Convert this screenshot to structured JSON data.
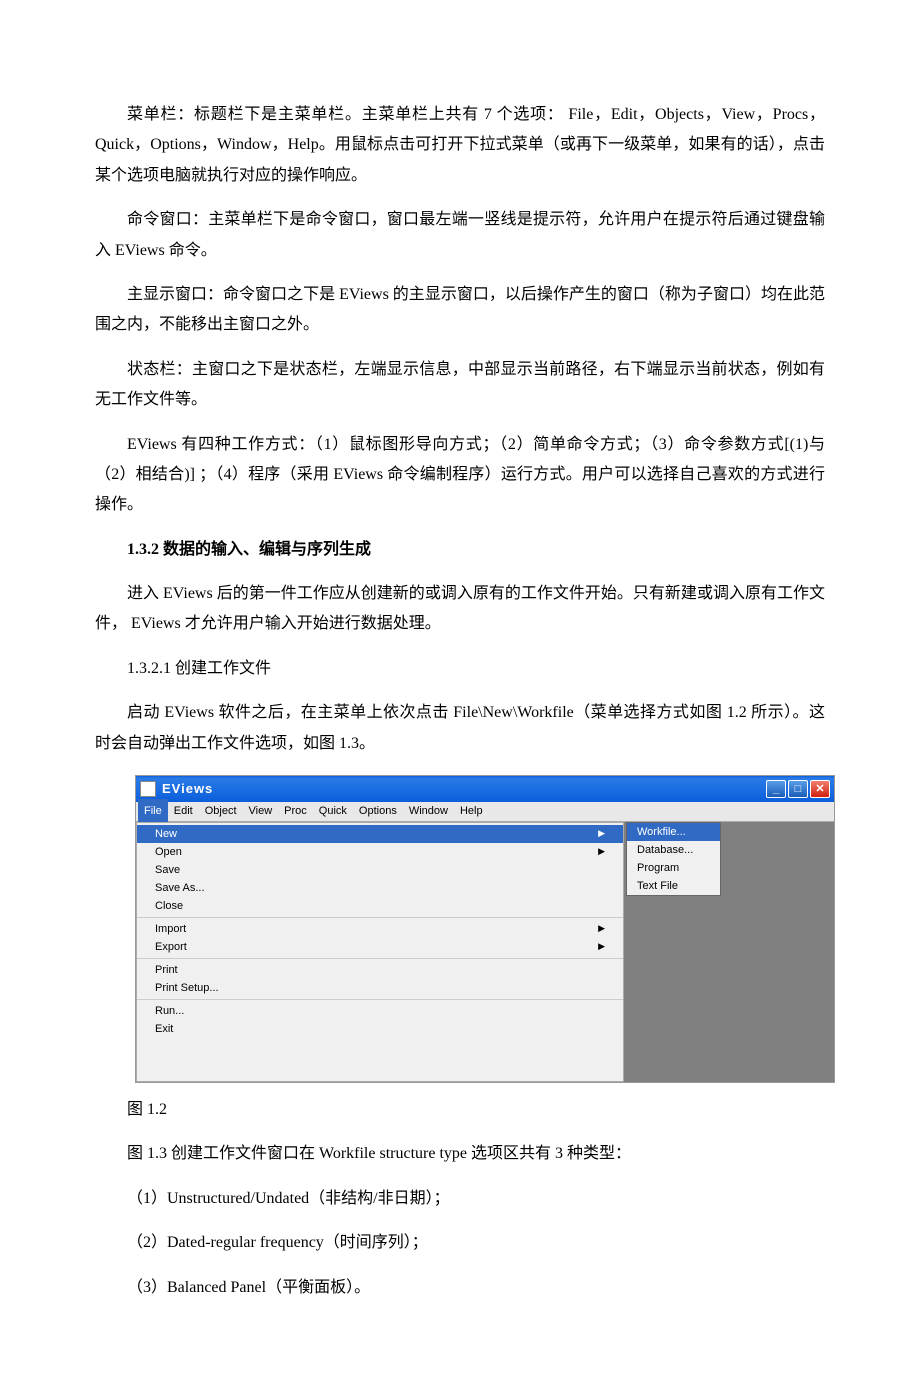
{
  "paragraphs": {
    "p1": "菜单栏：标题栏下是主菜单栏。主菜单栏上共有 7 个选项： File，Edit，Objects，View，Procs，Quick，Options，Window，Help。用鼠标点击可打开下拉式菜单（或再下一级菜单，如果有的话），点击某个选项电脑就执行对应的操作响应。",
    "p2": "命令窗口：主菜单栏下是命令窗口，窗口最左端一竖线是提示符，允许用户在提示符后通过键盘输入 EViews 命令。",
    "p3": "主显示窗口：命令窗口之下是 EViews 的主显示窗口，以后操作产生的窗口（称为子窗口）均在此范围之内，不能移出主窗口之外。",
    "p4": "状态栏：主窗口之下是状态栏，左端显示信息，中部显示当前路径，右下端显示当前状态，例如有无工作文件等。",
    "p5": "EViews 有四种工作方式：（1）鼠标图形导向方式；（2）简单命令方式；（3）命令参数方式[(1)与（2）相结合)] ；（4）程序（采用 EViews 命令编制程序）运行方式。用户可以选择自己喜欢的方式进行操作。",
    "h1": "1.3.2 数据的输入、编辑与序列生成",
    "p6": "进入 EViews 后的第一件工作应从创建新的或调入原有的工作文件开始。只有新建或调入原有工作文件， EViews 才允许用户输入开始进行数据处理。",
    "s1": "1.3.2.1 创建工作文件",
    "p7": "启动 EViews 软件之后，在主菜单上依次点击 File\\New\\Workfile（菜单选择方式如图 1.2 所示）。这时会自动弹出工作文件选项，如图 1.3。",
    "caption1": "图 1.2",
    "caption2": "图 1.3 创建工作文件窗口在 Workfile structure type 选项区共有 3 种类型：",
    "opt1": "（1）Unstructured/Undated（非结构/非日期）；",
    "opt2": "（2）Dated-regular frequency（时间序列）；",
    "opt3": "（3）Balanced Panel（平衡面板）。"
  },
  "app": {
    "title": "EViews",
    "menubar": [
      "File",
      "Edit",
      "Object",
      "View",
      "Proc",
      "Quick",
      "Options",
      "Window",
      "Help"
    ],
    "file_menu": {
      "group1": [
        {
          "label": "New",
          "arrow": true,
          "highlighted": true
        },
        {
          "label": "Open",
          "arrow": true
        },
        {
          "label": "Save"
        },
        {
          "label": "Save As..."
        },
        {
          "label": "Close"
        }
      ],
      "group2": [
        {
          "label": "Import",
          "arrow": true
        },
        {
          "label": "Export",
          "arrow": true
        }
      ],
      "group3": [
        {
          "label": "Print"
        },
        {
          "label": "Print Setup..."
        }
      ],
      "group4": [
        {
          "label": "Run..."
        },
        {
          "label": "Exit"
        }
      ]
    },
    "submenu": [
      {
        "label": "Workfile...",
        "highlighted": true
      },
      {
        "label": "Database..."
      },
      {
        "label": "Program"
      },
      {
        "label": "Text File"
      }
    ]
  }
}
